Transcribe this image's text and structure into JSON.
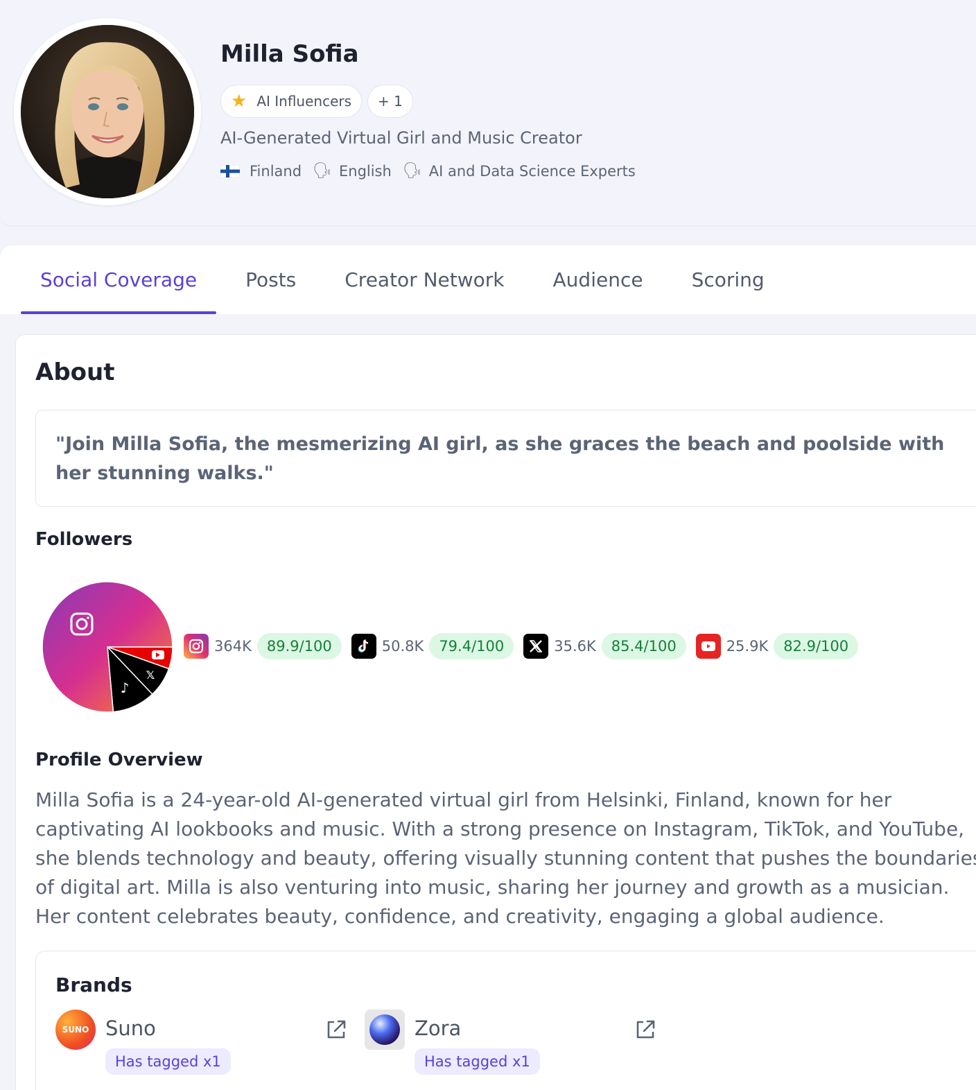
{
  "profile": {
    "name": "Milla Sofia",
    "category_chip": "AI Influencers",
    "more_chip": "+ 1",
    "tagline": "AI-Generated Virtual Girl and Music Creator",
    "country": "Finland",
    "language": "English",
    "expertise": "AI and Data Science Experts"
  },
  "tabs": [
    {
      "label": "Social Coverage",
      "active": true
    },
    {
      "label": "Posts",
      "active": false
    },
    {
      "label": "Creator Network",
      "active": false
    },
    {
      "label": "Audience",
      "active": false
    },
    {
      "label": "Scoring",
      "active": false
    }
  ],
  "about": {
    "title": "About",
    "quote": "\"Join Milla Sofia, the mesmerizing AI girl, as she graces the beach and poolside with her stunning walks.\""
  },
  "followers": {
    "title": "Followers",
    "platforms": [
      {
        "icon": "instagram-icon",
        "count": "364K",
        "score": "89.9/100",
        "followers": 364000
      },
      {
        "icon": "tiktok-icon",
        "count": "50.8K",
        "score": "79.4/100",
        "followers": 50800
      },
      {
        "icon": "x-icon",
        "count": "35.6K",
        "score": "85.4/100",
        "followers": 35600
      },
      {
        "icon": "youtube-icon",
        "count": "25.9K",
        "score": "82.9/100",
        "followers": 25900
      }
    ]
  },
  "overview": {
    "title": "Profile Overview",
    "text": "Milla Sofia is a 24-year-old AI-generated virtual girl from Helsinki, Finland, known for her captivating AI lookbooks and music. With a strong presence on Instagram, TikTok, and YouTube, she blends technology and beauty, offering visually stunning content that pushes the boundaries of digital art. Milla is also venturing into music, sharing her journey and growth as a musician. Her content celebrates beauty, confidence, and creativity, engaging a global audience."
  },
  "brands": {
    "title": "Brands",
    "items": [
      {
        "name": "Suno",
        "logo_text": "SUNO",
        "tag": "Has tagged x1"
      },
      {
        "name": "Zora",
        "tag": "Has tagged x1"
      }
    ]
  },
  "colors": {
    "accent": "#5b3fd9",
    "score_bg": "#dcf7e3",
    "score_text": "#15803d"
  }
}
